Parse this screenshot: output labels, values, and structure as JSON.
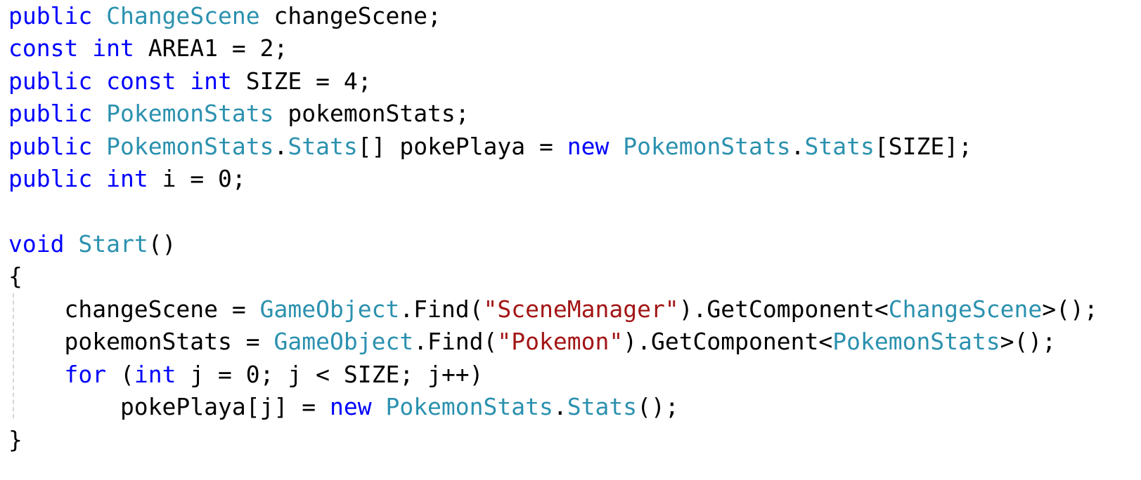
{
  "code": {
    "lines": [
      {
        "tokens": [
          {
            "k": "kw",
            "t": "public"
          },
          {
            "k": "plain",
            "t": " "
          },
          {
            "k": "type",
            "t": "ChangeScene"
          },
          {
            "k": "plain",
            "t": " changeScene;"
          }
        ]
      },
      {
        "tokens": [
          {
            "k": "kw",
            "t": "const"
          },
          {
            "k": "plain",
            "t": " "
          },
          {
            "k": "kw",
            "t": "int"
          },
          {
            "k": "plain",
            "t": " AREA1 = 2;"
          }
        ]
      },
      {
        "tokens": [
          {
            "k": "kw",
            "t": "public"
          },
          {
            "k": "plain",
            "t": " "
          },
          {
            "k": "kw",
            "t": "const"
          },
          {
            "k": "plain",
            "t": " "
          },
          {
            "k": "kw",
            "t": "int"
          },
          {
            "k": "plain",
            "t": " SIZE = 4;"
          }
        ]
      },
      {
        "tokens": [
          {
            "k": "kw",
            "t": "public"
          },
          {
            "k": "plain",
            "t": " "
          },
          {
            "k": "type",
            "t": "PokemonStats"
          },
          {
            "k": "plain",
            "t": " pokemonStats;"
          }
        ]
      },
      {
        "tokens": [
          {
            "k": "kw",
            "t": "public"
          },
          {
            "k": "plain",
            "t": " "
          },
          {
            "k": "type",
            "t": "PokemonStats"
          },
          {
            "k": "plain",
            "t": "."
          },
          {
            "k": "type",
            "t": "Stats"
          },
          {
            "k": "plain",
            "t": "[] pokePlaya = "
          },
          {
            "k": "kw",
            "t": "new"
          },
          {
            "k": "plain",
            "t": " "
          },
          {
            "k": "type",
            "t": "PokemonStats"
          },
          {
            "k": "plain",
            "t": "."
          },
          {
            "k": "type",
            "t": "Stats"
          },
          {
            "k": "plain",
            "t": "[SIZE];"
          }
        ]
      },
      {
        "tokens": [
          {
            "k": "kw",
            "t": "public"
          },
          {
            "k": "plain",
            "t": " "
          },
          {
            "k": "kw",
            "t": "int"
          },
          {
            "k": "plain",
            "t": " i = 0;"
          }
        ]
      },
      {
        "tokens": []
      },
      {
        "tokens": [
          {
            "k": "kw",
            "t": "void"
          },
          {
            "k": "plain",
            "t": " "
          },
          {
            "k": "type",
            "t": "Start"
          },
          {
            "k": "plain",
            "t": "()"
          }
        ]
      },
      {
        "tokens": [
          {
            "k": "plain",
            "t": "{"
          }
        ]
      },
      {
        "tokens": [
          {
            "k": "plain",
            "t": "    changeScene = "
          },
          {
            "k": "type",
            "t": "GameObject"
          },
          {
            "k": "plain",
            "t": ".Find("
          },
          {
            "k": "str",
            "t": "\"SceneManager\""
          },
          {
            "k": "plain",
            "t": ").GetComponent<"
          },
          {
            "k": "type",
            "t": "ChangeScene"
          },
          {
            "k": "plain",
            "t": ">();"
          }
        ]
      },
      {
        "tokens": [
          {
            "k": "plain",
            "t": "    pokemonStats = "
          },
          {
            "k": "type",
            "t": "GameObject"
          },
          {
            "k": "plain",
            "t": ".Find("
          },
          {
            "k": "str",
            "t": "\"Pokemon\""
          },
          {
            "k": "plain",
            "t": ").GetComponent<"
          },
          {
            "k": "type",
            "t": "PokemonStats"
          },
          {
            "k": "plain",
            "t": ">();"
          }
        ]
      },
      {
        "tokens": [
          {
            "k": "plain",
            "t": "    "
          },
          {
            "k": "kw",
            "t": "for"
          },
          {
            "k": "plain",
            "t": " ("
          },
          {
            "k": "kw",
            "t": "int"
          },
          {
            "k": "plain",
            "t": " j = 0; j < SIZE; j++)"
          }
        ]
      },
      {
        "tokens": [
          {
            "k": "plain",
            "t": "        pokePlaya[j] = "
          },
          {
            "k": "kw",
            "t": "new"
          },
          {
            "k": "plain",
            "t": " "
          },
          {
            "k": "type",
            "t": "PokemonStats"
          },
          {
            "k": "plain",
            "t": "."
          },
          {
            "k": "type",
            "t": "Stats"
          },
          {
            "k": "plain",
            "t": "();"
          }
        ]
      },
      {
        "tokens": [
          {
            "k": "plain",
            "t": "}"
          }
        ]
      }
    ]
  },
  "colors": {
    "keyword": "#0000ff",
    "type": "#2b91af",
    "string": "#a31515",
    "plain": "#000000",
    "background": "#ffffff"
  }
}
